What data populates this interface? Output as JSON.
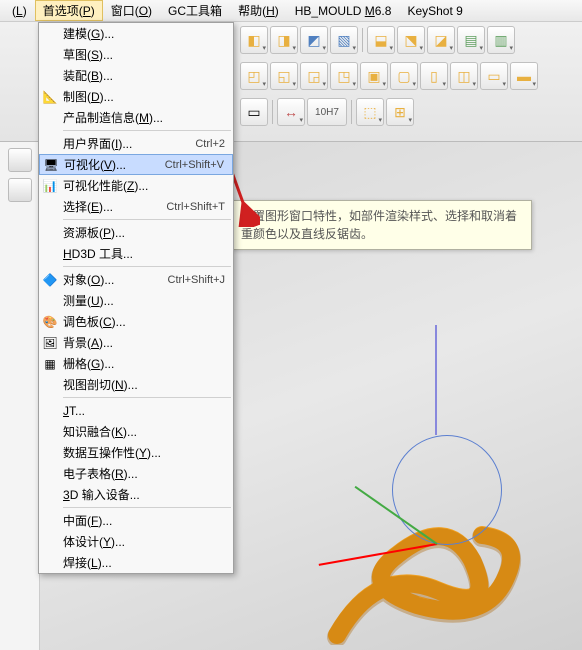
{
  "menubar": {
    "items": [
      {
        "label": "(L)"
      },
      {
        "label": "首选项(P)",
        "active": true
      },
      {
        "label": "窗口(O)"
      },
      {
        "label": "GC工具箱"
      },
      {
        "label": "帮助(H)"
      },
      {
        "label": "HB_MOULD M6.8"
      },
      {
        "label": "KeyShot 9"
      }
    ]
  },
  "dropdown": {
    "groups": [
      [
        {
          "icon": "",
          "label": "建模(G)..."
        },
        {
          "icon": "",
          "label": "草图(S)..."
        },
        {
          "icon": "",
          "label": "装配(B)..."
        },
        {
          "icon": "📐",
          "label": "制图(D)..."
        },
        {
          "icon": "",
          "label": "产品制造信息(M)..."
        }
      ],
      [
        {
          "icon": "",
          "label": "用户界面(I)...",
          "shortcut": "Ctrl+2"
        },
        {
          "icon": "🖥",
          "label": "可视化(V)...",
          "shortcut": "Ctrl+Shift+V",
          "hl": true
        },
        {
          "icon": "📊",
          "label": "可视化性能(Z)..."
        },
        {
          "icon": "",
          "label": "选择(E)...",
          "shortcut": "Ctrl+Shift+T"
        }
      ],
      [
        {
          "icon": "",
          "label": "资源板(P)..."
        },
        {
          "icon": "",
          "label": "HD3D 工具..."
        }
      ],
      [
        {
          "icon": "🔷",
          "label": "对象(O)...",
          "shortcut": "Ctrl+Shift+J"
        },
        {
          "icon": "",
          "label": "测量(U)..."
        },
        {
          "icon": "🎨",
          "label": "调色板(C)..."
        },
        {
          "icon": "🖼",
          "label": "背景(A)..."
        },
        {
          "icon": "▦",
          "label": "栅格(G)..."
        },
        {
          "icon": "",
          "label": "视图剖切(N)..."
        }
      ],
      [
        {
          "icon": "",
          "label": "JT..."
        },
        {
          "icon": "",
          "label": "知识融合(K)..."
        },
        {
          "icon": "",
          "label": "数据互操作性(Y)..."
        },
        {
          "icon": "",
          "label": "电子表格(R)..."
        },
        {
          "icon": "",
          "label": "3D 输入设备..."
        }
      ],
      [
        {
          "icon": "",
          "label": "中面(F)..."
        },
        {
          "icon": "",
          "label": "体设计(Y)..."
        },
        {
          "icon": "",
          "label": "焊接(L)..."
        }
      ]
    ]
  },
  "tooltip": {
    "text": "设置图形窗口特性，如部件渲染样式、选择和取消着重颜色以及直线反锯齿。"
  },
  "toolbar": {
    "row3": {
      "dim_label": "10H7"
    }
  },
  "colors": {
    "coil": "#f0a020"
  }
}
